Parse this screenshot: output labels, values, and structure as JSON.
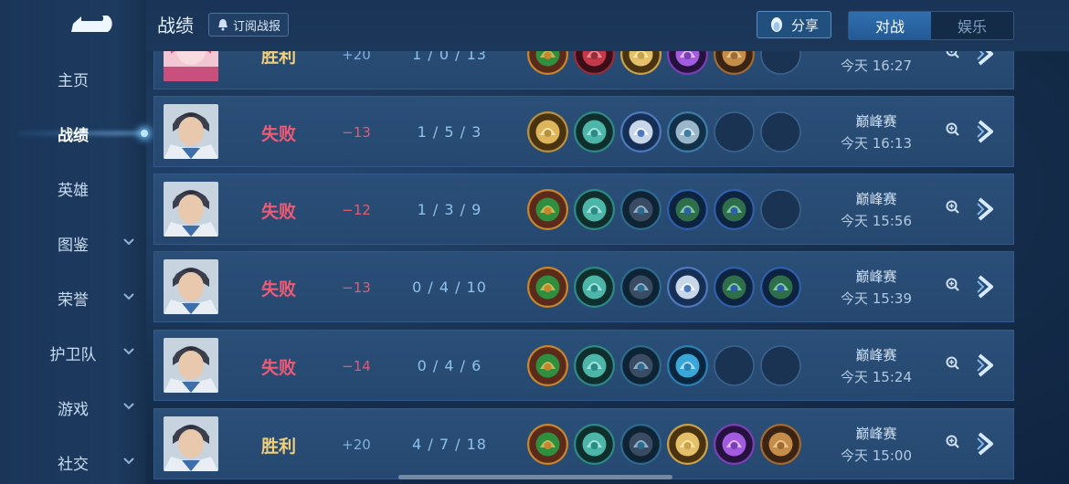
{
  "sidebar": {
    "back_icon": "back-arrow-icon",
    "items": [
      {
        "label": "主页",
        "expandable": false,
        "active": false
      },
      {
        "label": "战绩",
        "expandable": false,
        "active": true
      },
      {
        "label": "英雄",
        "expandable": false,
        "active": false
      },
      {
        "label": "图鉴",
        "expandable": true,
        "active": false
      },
      {
        "label": "荣誉",
        "expandable": true,
        "active": false
      },
      {
        "label": "护卫队",
        "expandable": true,
        "active": false
      },
      {
        "label": "游戏",
        "expandable": true,
        "active": false
      },
      {
        "label": "社交",
        "expandable": true,
        "active": false
      }
    ]
  },
  "header": {
    "title": "战绩",
    "subscribe_label": "订阅战报",
    "share_label": "分享",
    "tabs": [
      {
        "label": "对战",
        "active": true
      },
      {
        "label": "娱乐",
        "active": false
      }
    ]
  },
  "matches": [
    {
      "result": "胜利",
      "outcome": "win",
      "score": "+20",
      "kda": "1 / 0 / 13",
      "mode": "",
      "time": "今天 16:27",
      "items": [
        "green-orb",
        "red-gem",
        "gold-crown",
        "purple-gem",
        "bronze-helm",
        "empty"
      ]
    },
    {
      "result": "失败",
      "outcome": "loss",
      "score": "−13",
      "kda": "1 / 5 / 3",
      "mode": "巅峰赛",
      "time": "今天 16:13",
      "items": [
        "gold-blade",
        "boots",
        "silver-mask",
        "winged-bar",
        "empty",
        "empty"
      ]
    },
    {
      "result": "失败",
      "outcome": "loss",
      "score": "−12",
      "kda": "1 / 3 / 9",
      "mode": "巅峰赛",
      "time": "今天 15:56",
      "items": [
        "green-orb",
        "boots",
        "dark-armor",
        "green-hood",
        "green-hood",
        "empty"
      ]
    },
    {
      "result": "失败",
      "outcome": "loss",
      "score": "−13",
      "kda": "0 / 4 / 10",
      "mode": "巅峰赛",
      "time": "今天 15:39",
      "items": [
        "green-orb",
        "boots",
        "dark-armor",
        "silver-mask",
        "green-hood",
        "green-hood"
      ]
    },
    {
      "result": "失败",
      "outcome": "loss",
      "score": "−14",
      "kda": "0 / 4 / 6",
      "mode": "巅峰赛",
      "time": "今天 15:24",
      "items": [
        "green-orb",
        "boots",
        "dark-armor",
        "blue-scroll",
        "empty",
        "empty"
      ]
    },
    {
      "result": "胜利",
      "outcome": "win",
      "score": "+20",
      "kda": "4 / 7 / 18",
      "mode": "巅峰赛",
      "time": "今天 15:00",
      "items": [
        "green-orb",
        "boots",
        "dark-armor",
        "gold-crown",
        "purple-gem",
        "bronze-helm"
      ]
    }
  ],
  "colors": {
    "win": "#f1cf7a",
    "loss": "#f05a74",
    "accent": "#2f6fb0"
  }
}
